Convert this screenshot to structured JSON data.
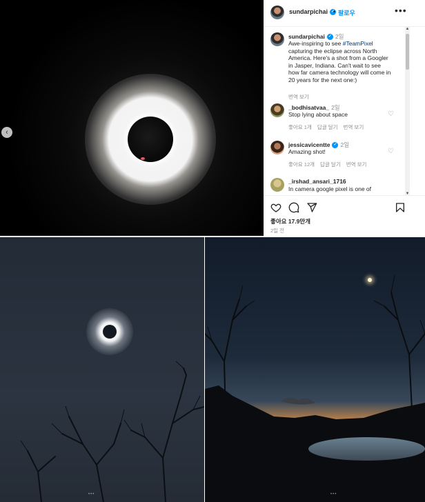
{
  "post": {
    "username": "sundarpichai",
    "header_dot": "•",
    "follow": "팔로우",
    "more": "•••",
    "prev_arrow": "‹",
    "caption": {
      "user": "sundarpichai",
      "time": "2일",
      "text_before": "Awe-inspiring to see ",
      "hashtag": "#TeamPixel",
      "text_after": " capturing the eclipse across North America. Here's a shot from a Googler in Jasper, Indiana. Can't wait to see how far camera technology will come in 20 years for the next one:)",
      "translate": "번역 보기"
    },
    "comments": [
      {
        "user": "_bodhisatvaa_",
        "time": "2일",
        "text": "Stop lying about space",
        "likes": "좋아요 1개",
        "reply": "답글 달기",
        "translate": "번역 보기",
        "verified": false
      },
      {
        "user": "jessicavicentte",
        "time": "2일",
        "text": "Amazing shot!",
        "likes": "좋아요 12개",
        "reply": "답글 달기",
        "translate": "번역 보기",
        "verified": true
      },
      {
        "user": "_irshad_ansari_1716",
        "time": "2일",
        "text": "In camera google pixel is one of",
        "verified": false
      }
    ],
    "likes_count": "좋아요 17.9만개",
    "age": "2일 전"
  },
  "icons": [
    "heart-icon",
    "comment-icon",
    "share-icon",
    "bookmark-icon",
    "verified-icon",
    "more-icon"
  ],
  "colors": {
    "link": "#0095f6",
    "verified": "#0095f6",
    "muted": "#8e8e8e",
    "text": "#262626"
  },
  "carousel": {
    "left_dots": "•••",
    "right_dots": "•••"
  }
}
